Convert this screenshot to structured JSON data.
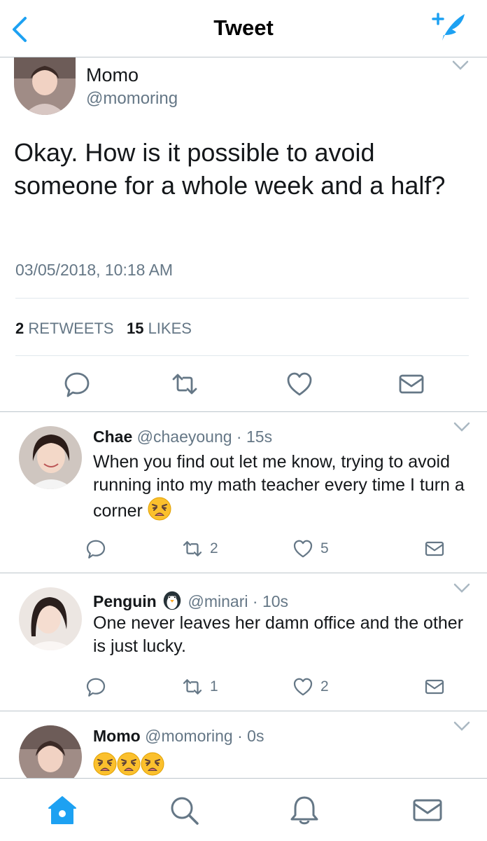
{
  "nav": {
    "title": "Tweet",
    "back_icon": "chevron-left-icon",
    "compose_icon": "compose-tweet-icon",
    "accent": "#1da1f2"
  },
  "main_tweet": {
    "name": "Momo",
    "handle": "@momoring",
    "text": "Okay. How is it possible to avoid someone for a whole week and a half?",
    "timestamp": "03/05/2018, 10:18 AM",
    "retweets_count": "2",
    "retweets_label": "RETWEETS",
    "likes_count": "15",
    "likes_label": "LIKES",
    "actions": [
      "reply-icon",
      "retweet-icon",
      "like-icon",
      "dm-icon"
    ]
  },
  "replies": [
    {
      "name": "Chae",
      "handle": "@chaeyoung",
      "dot": "·",
      "time": "15s",
      "text": "When you find out let me know, trying to avoid running into my math teacher every time I turn a corner",
      "emoji": [
        "weary-face"
      ],
      "retweets": "2",
      "likes": "5"
    },
    {
      "name": "Penguin",
      "name_emoji": "penguin",
      "handle": "@minari",
      "dot": "·",
      "time": "10s",
      "text": "One never leaves her damn office and the other is just lucky.",
      "retweets": "1",
      "likes": "2"
    },
    {
      "name": "Momo",
      "handle": "@momoring",
      "dot": "·",
      "time": "0s",
      "text": "",
      "emoji": [
        "weary-face",
        "weary-face",
        "weary-face"
      ]
    }
  ],
  "tabbar": {
    "items": [
      "home-icon",
      "search-icon",
      "notifications-icon",
      "messages-icon"
    ],
    "active": "home-icon"
  }
}
